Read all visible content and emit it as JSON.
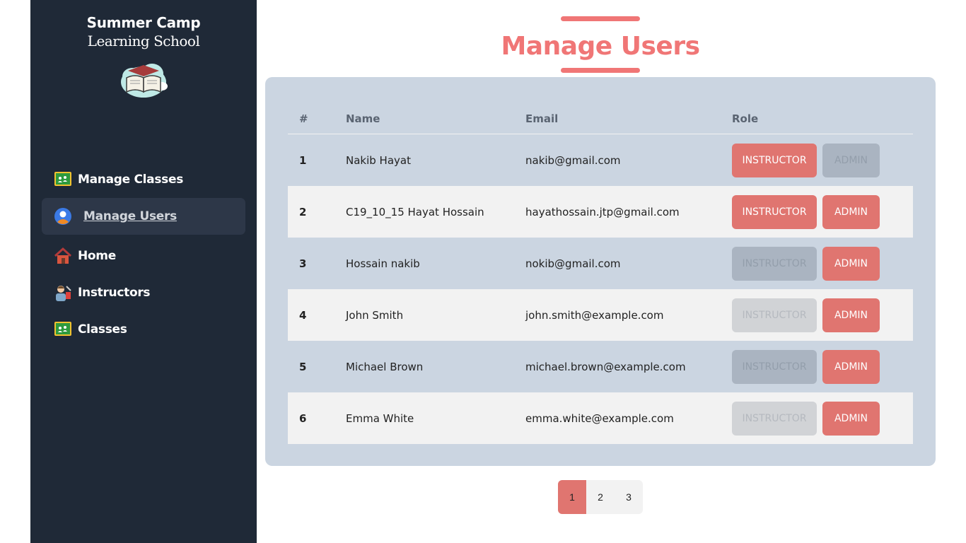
{
  "brand": {
    "line1": "Summer Camp",
    "line2": "Learning School"
  },
  "nav": {
    "items": [
      {
        "label": "Manage Classes",
        "icon": "classroom-board-icon",
        "active": false
      },
      {
        "label": "Manage Users",
        "icon": "user-circle-icon",
        "active": true
      },
      {
        "label": "Home",
        "icon": "house-icon",
        "active": false
      },
      {
        "label": "Instructors",
        "icon": "teacher-icon",
        "active": false
      },
      {
        "label": "Classes",
        "icon": "classroom-board-icon",
        "active": false
      }
    ]
  },
  "page": {
    "title": "Manage Users"
  },
  "table": {
    "headers": {
      "num": "#",
      "name": "Name",
      "email": "Email",
      "role": "Role"
    },
    "rows": [
      {
        "num": "1",
        "name": "Nakib Hayat",
        "email": "nakib@gmail.com",
        "instructor": "INSTRUCTOR",
        "admin": "ADMIN"
      },
      {
        "num": "2",
        "name": "C19_10_15 Hayat Hossain",
        "email": "hayathossain.jtp@gmail.com",
        "instructor": "INSTRUCTOR",
        "admin": "ADMIN"
      },
      {
        "num": "3",
        "name": "Hossain nakib",
        "email": "nokib@gmail.com",
        "instructor": "INSTRUCTOR",
        "admin": "ADMIN"
      },
      {
        "num": "4",
        "name": "John Smith",
        "email": "john.smith@example.com",
        "instructor": "INSTRUCTOR",
        "admin": "ADMIN"
      },
      {
        "num": "5",
        "name": "Michael Brown",
        "email": "michael.brown@example.com",
        "instructor": "INSTRUCTOR",
        "admin": "ADMIN"
      },
      {
        "num": "6",
        "name": "Emma White",
        "email": "emma.white@example.com",
        "instructor": "INSTRUCTOR",
        "admin": "ADMIN"
      }
    ]
  },
  "pagination": {
    "pages": [
      "1",
      "2",
      "3"
    ],
    "current": "1"
  },
  "colors": {
    "accent": "#f07676",
    "button_active": "#e07570",
    "sidebar_bg": "#1f2937",
    "card_bg": "#cbd5e1"
  }
}
